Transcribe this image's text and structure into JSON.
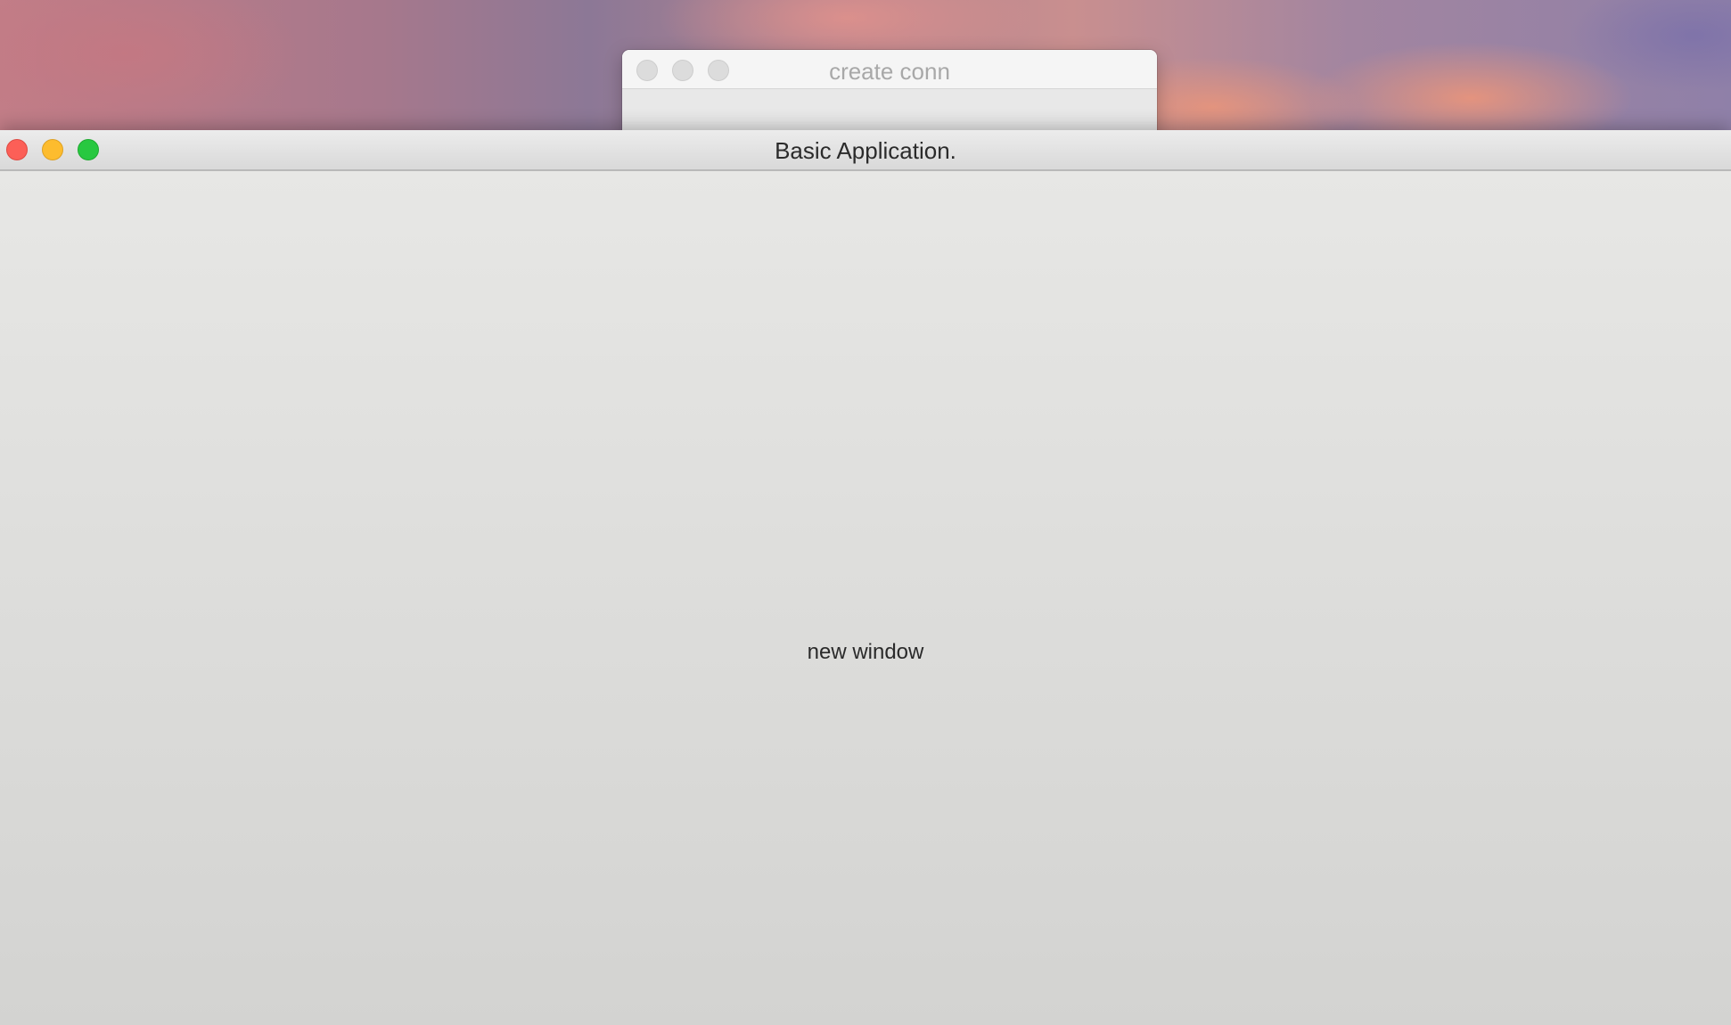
{
  "background_window": {
    "title": "create conn",
    "state": "inactive"
  },
  "main_window": {
    "title": "Basic Application.",
    "content_text": "new window",
    "state": "active"
  },
  "colors": {
    "close": "#fc5f57",
    "minimize": "#fdbc2e",
    "zoom": "#28c840",
    "inactive_button": "#dcdcdc"
  }
}
